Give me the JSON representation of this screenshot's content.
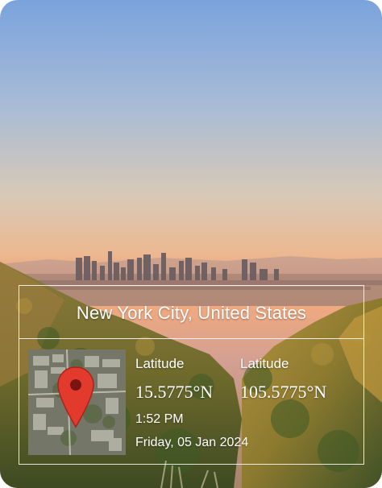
{
  "location": {
    "title": "New York City, United States"
  },
  "coordinates": {
    "latitude_label": "Latitude",
    "latitude_value": "15.5775°N",
    "second_label": "Latitude",
    "second_value": "105.5775°N"
  },
  "meta": {
    "time": "1:52 PM",
    "date": "Friday, 05 Jan 2024"
  },
  "icons": {
    "map_pin": "map-pin-icon"
  },
  "colors": {
    "pin": "#e23b2e",
    "pin_dark": "#7a1410",
    "overlay_line": "#ffffff"
  }
}
